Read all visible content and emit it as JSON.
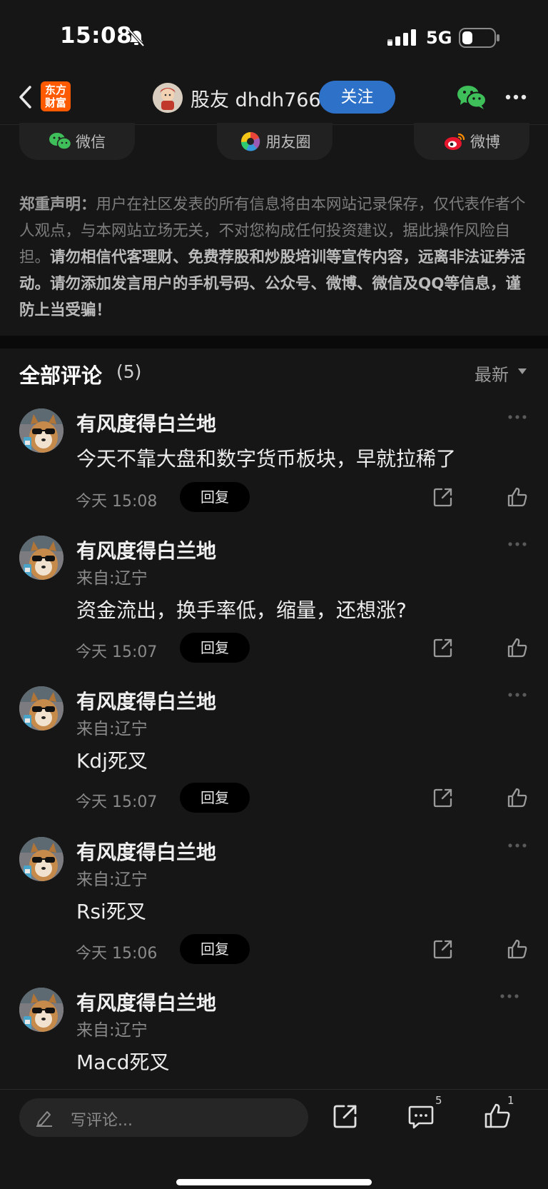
{
  "status_bar": {
    "time": "15:08",
    "network": "5G"
  },
  "nav": {
    "logo_line1": "东方",
    "logo_line2": "财富",
    "username": "股友 dhdh766",
    "follow_label": "关注"
  },
  "share": {
    "wechat": "微信",
    "moments": "朋友圈",
    "weibo": "微博"
  },
  "disclaimer": {
    "title": "郑重声明：",
    "body": "用户在社区发表的所有信息将由本网站记录保存，仅代表作者个人观点，与本网站立场无关，不对您构成任何投资建议，据此操作风险自担。",
    "warning": "请勿相信代客理财、免费荐股和炒股培训等宣传内容，远离非法证券活动。请勿添加发言用户的手机号码、公众号、微博、微信及QQ等信息，谨防上当受骗！"
  },
  "comments_section": {
    "title": "全部评论",
    "count": "(5)",
    "sort": "最新"
  },
  "comments": [
    {
      "name": "有风度得白兰地",
      "location": "",
      "text": "今天不靠大盘和数字货币板块，早就拉稀了",
      "time": "今天 15:08",
      "reply": "回复"
    },
    {
      "name": "有风度得白兰地",
      "location": "来自:辽宁",
      "text": "资金流出，换手率低，缩量，还想涨?",
      "time": "今天 15:07",
      "reply": "回复"
    },
    {
      "name": "有风度得白兰地",
      "location": "来自:辽宁",
      "text": "Kdj死叉",
      "time": "今天 15:07",
      "reply": "回复"
    },
    {
      "name": "有风度得白兰地",
      "location": "来自:辽宁",
      "text": "Rsi死叉",
      "time": "今天 15:06",
      "reply": "回复"
    },
    {
      "name": "有风度得白兰地",
      "location": "来自:辽宁",
      "text": "Macd死叉",
      "time": "",
      "reply": ""
    }
  ],
  "bottom_bar": {
    "placeholder": "写评论...",
    "comment_badge": "5",
    "like_badge": "1"
  },
  "colors": {
    "background": "#161616",
    "follow_button": "#2d71c9",
    "logo": "#ff5a00"
  }
}
